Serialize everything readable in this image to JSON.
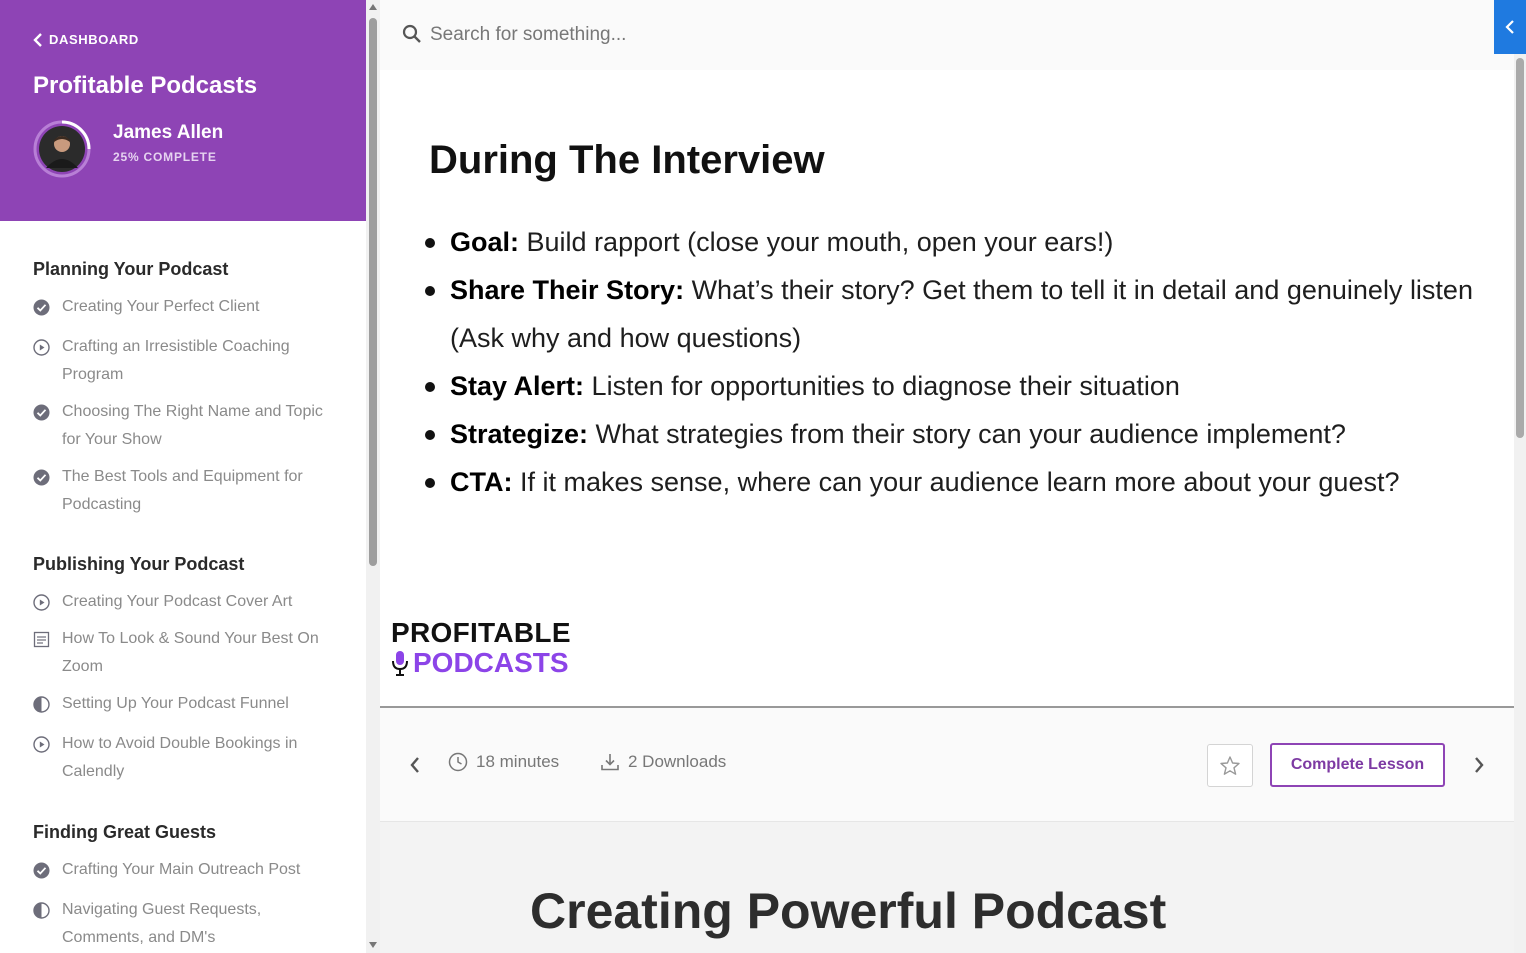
{
  "sidebar": {
    "back_label": "DASHBOARD",
    "course_title": "Profitable Podcasts",
    "user": {
      "name": "James Allen",
      "progress_label": "25% COMPLETE",
      "progress_fraction": 0.25
    },
    "sections": [
      {
        "title": "Planning Your Podcast",
        "lessons": [
          {
            "label": "Creating Your Perfect Client",
            "status": "completed",
            "icon": "check-circle-icon"
          },
          {
            "label": "Crafting an Irresistible Coaching Program",
            "status": "video",
            "icon": "play-circle-icon"
          },
          {
            "label": "Choosing The Right Name and Topic for Your Show",
            "status": "completed",
            "icon": "check-circle-icon"
          },
          {
            "label": "The Best Tools and Equipment for Podcasting",
            "status": "completed",
            "icon": "check-circle-icon"
          }
        ]
      },
      {
        "title": "Publishing Your Podcast",
        "lessons": [
          {
            "label": "Creating Your Podcast Cover Art",
            "status": "video",
            "icon": "play-circle-icon"
          },
          {
            "label": "How To Look & Sound Your Best On Zoom",
            "status": "text",
            "icon": "document-icon"
          },
          {
            "label": "Setting Up Your Podcast Funnel",
            "status": "partial",
            "icon": "half-circle-icon"
          },
          {
            "label": "How to Avoid Double Bookings in Calendly",
            "status": "video",
            "icon": "play-circle-icon"
          }
        ]
      },
      {
        "title": "Finding Great Guests",
        "lessons": [
          {
            "label": "Crafting Your Main Outreach Post",
            "status": "completed",
            "icon": "check-circle-icon"
          },
          {
            "label": "Navigating Guest Requests, Comments, and DM's",
            "status": "partial",
            "icon": "half-circle-icon"
          }
        ]
      }
    ]
  },
  "search": {
    "placeholder": "Search for something..."
  },
  "slide": {
    "title": "During The Interview",
    "bullets": [
      {
        "term": "Goal:",
        "text": " Build rapport (close your mouth, open your ears!)"
      },
      {
        "term": "Share Their Story:",
        "text": " What’s their story? Get them to tell it in detail and genuinely listen (Ask why and how questions)"
      },
      {
        "term": "Stay Alert:",
        "text": " Listen for opportunities to diagnose their situation"
      },
      {
        "term": "Strategize:",
        "text": " What strategies from their story can your audience implement?"
      },
      {
        "term": "CTA:",
        "text": " If it makes sense, where can your audience learn more about your guest?"
      }
    ],
    "logo_line1": "PROFITABLE",
    "logo_line2": "PODCASTS"
  },
  "lesson_bar": {
    "duration": "18 minutes",
    "downloads": "2 Downloads",
    "complete_label": "Complete Lesson"
  },
  "next_content": {
    "title": "Creating Powerful Podcast"
  },
  "colors": {
    "brand": "#8e44b5",
    "accent_blue": "#1f7ae0",
    "logo_purple": "#8c44e8"
  }
}
